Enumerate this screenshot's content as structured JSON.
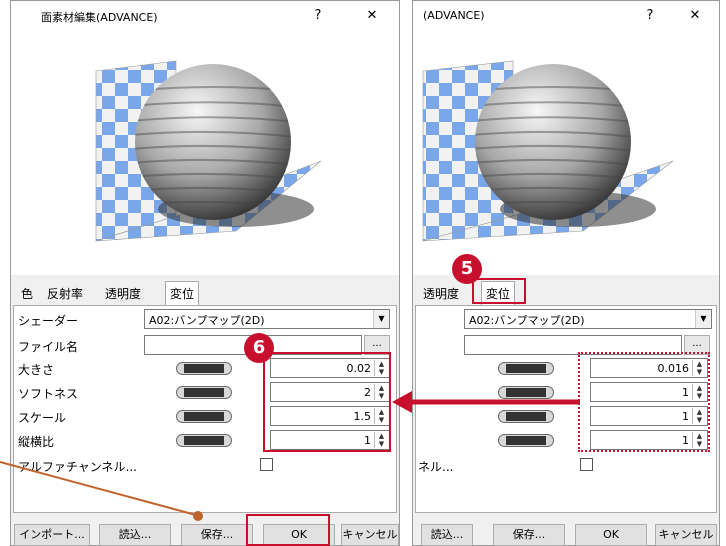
{
  "left_window": {
    "title": "面素材編集(ADVANCE)",
    "help_label": "?",
    "close_label": "✕",
    "tabs": [
      "色",
      "反射率",
      "透明度",
      "変位"
    ],
    "shader_label": "シェーダー",
    "shader_value": "A02:バンプマップ(2D)",
    "file_label": "ファイル名",
    "browse_label": "...",
    "params": [
      {
        "label": "大きさ",
        "value": "0.02"
      },
      {
        "label": "ソフトネス",
        "value": "2"
      },
      {
        "label": "スケール",
        "value": "1.5"
      },
      {
        "label": "縦横比",
        "value": "1"
      }
    ],
    "alpha_label": "アルファチャンネル...",
    "buttons": {
      "import": "インポート...",
      "load": "読込...",
      "save": "保存...",
      "ok": "OK",
      "cancel": "キャンセル"
    }
  },
  "right_window": {
    "title": "(ADVANCE)",
    "help_label": "?",
    "close_label": "✕",
    "tabs": [
      "透明度",
      "変位"
    ],
    "shader_value": "A02:バンプマップ(2D)",
    "browse_label": "...",
    "values": [
      "0.016",
      "1",
      "1",
      "1"
    ],
    "alpha_label_fragment": "ネル...",
    "buttons": {
      "load": "読込...",
      "save": "保存...",
      "ok": "OK",
      "cancel": "キャンセル"
    }
  },
  "annotations": {
    "step5": "5",
    "step6": "6"
  },
  "colors": {
    "highlight": "#c8102e",
    "pointer_line": "#c0622b",
    "checker_blue": "#7aa7ea"
  }
}
